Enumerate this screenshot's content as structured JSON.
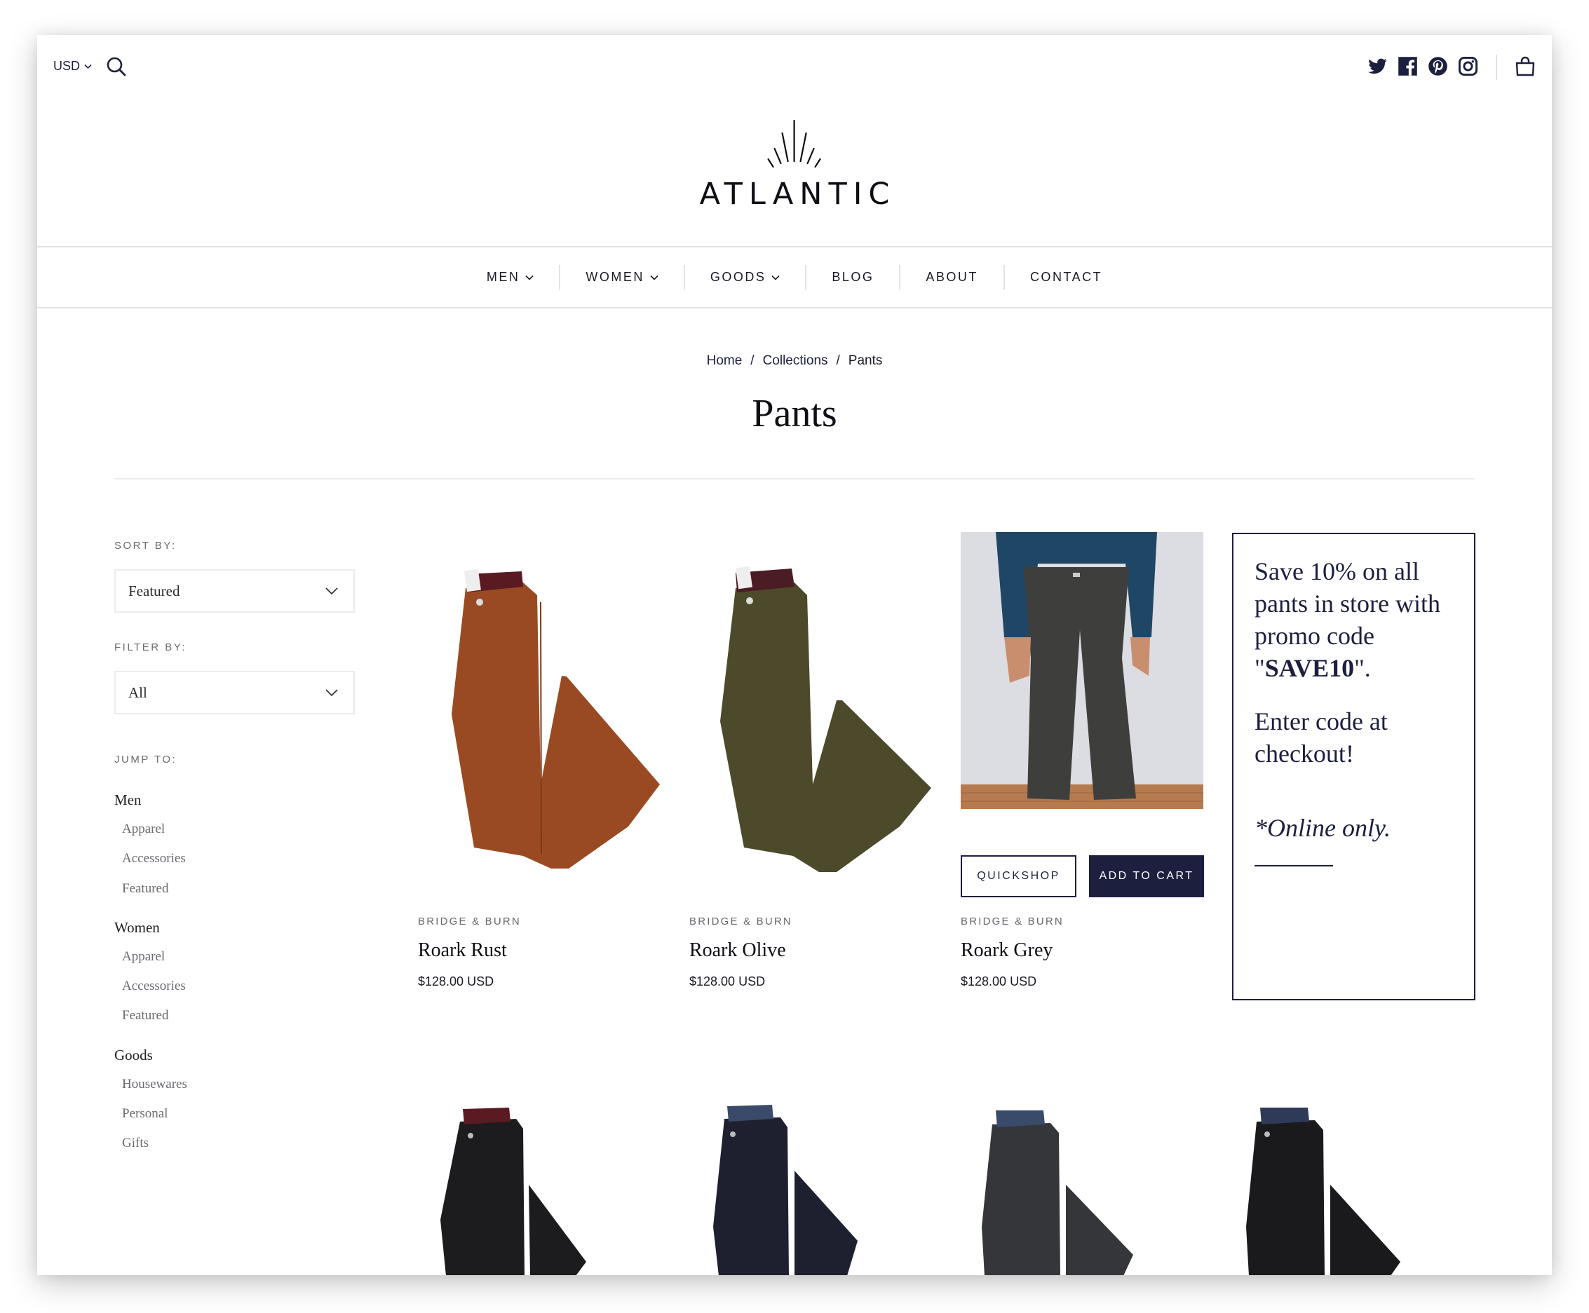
{
  "topbar": {
    "currency": "USD",
    "icons": [
      "search-icon",
      "twitter-icon",
      "facebook-icon",
      "pinterest-icon",
      "instagram-icon",
      "shopping-bag-icon"
    ]
  },
  "logo": {
    "text": "ATLANTIC"
  },
  "nav": {
    "items": [
      {
        "label": "MEN",
        "has_dropdown": true
      },
      {
        "label": "WOMEN",
        "has_dropdown": true
      },
      {
        "label": "GOODS",
        "has_dropdown": true
      },
      {
        "label": "BLOG",
        "has_dropdown": false
      },
      {
        "label": "ABOUT",
        "has_dropdown": false
      },
      {
        "label": "CONTACT",
        "has_dropdown": false
      }
    ]
  },
  "breadcrumb": {
    "items": [
      "Home",
      "Collections",
      "Pants"
    ],
    "separator": "/"
  },
  "page": {
    "title": "Pants"
  },
  "sidebar": {
    "sort_label": "SORT BY:",
    "sort_value": "Featured",
    "filter_label": "FILTER BY:",
    "filter_value": "All",
    "jump_label": "JUMP TO:",
    "groups": [
      {
        "title": "Men",
        "items": [
          "Apparel",
          "Accessories",
          "Featured"
        ]
      },
      {
        "title": "Women",
        "items": [
          "Apparel",
          "Accessories",
          "Featured"
        ]
      },
      {
        "title": "Goods",
        "items": [
          "Housewares",
          "Personal",
          "Gifts"
        ]
      }
    ]
  },
  "products": [
    {
      "brand": "BRIDGE & BURN",
      "name": "Roark Rust",
      "price": "$128.00 USD",
      "color": "#9a4a22"
    },
    {
      "brand": "BRIDGE & BURN",
      "name": "Roark Olive",
      "price": "$128.00 USD",
      "color": "#4c4a2a"
    },
    {
      "brand": "BRIDGE & BURN",
      "name": "Roark Grey",
      "price": "$128.00 USD",
      "color": "#3e3f3d"
    }
  ],
  "product_actions": {
    "quickshop": "QUICKSHOP",
    "add_to_cart": "ADD TO CART"
  },
  "second_row_colors": [
    "#1c1c1e",
    "#1e2030",
    "#35363a",
    "#1a1a1c"
  ],
  "promo": {
    "line1_prefix": "Save 10% on all pants in store with promo code \"",
    "code": "SAVE10",
    "line1_suffix": "\".",
    "line2": "Enter code at checkout!",
    "note": "*Online only."
  },
  "colors": {
    "navy": "#1d1f3f",
    "border": "#ececec"
  }
}
